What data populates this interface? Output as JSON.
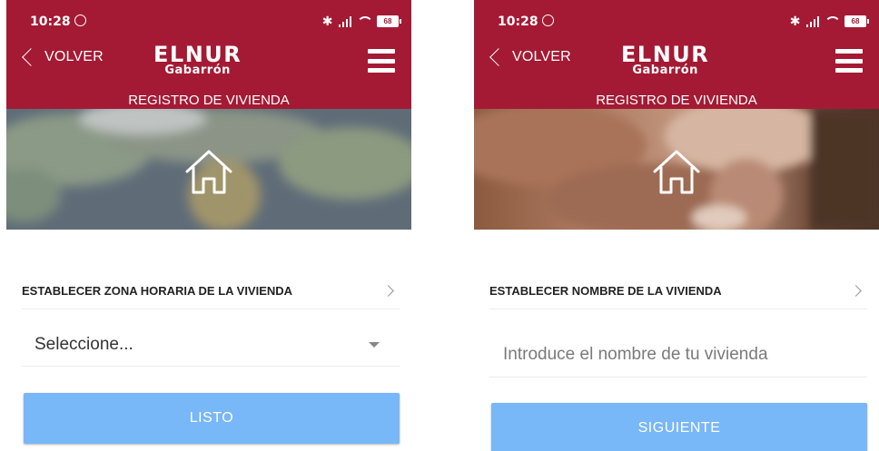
{
  "colors": {
    "brand": "#a41a34",
    "button": "#78b7f8"
  },
  "screens": [
    {
      "status_time": "10:28",
      "battery": "68",
      "back_label": "VOLVER",
      "logo_main": "ELNUR",
      "logo_sub": "Gabarrón",
      "page_title": "REGISTRO DE VIVIENDA",
      "banner_image": "world-map",
      "section_label": "ESTABLECER ZONA HORARIA DE LA VIVIENDA",
      "select_value": "Seleccione...",
      "button_label": "LISTO"
    },
    {
      "status_time": "10:28",
      "battery": "68",
      "back_label": "VOLVER",
      "logo_main": "ELNUR",
      "logo_sub": "Gabarrón",
      "page_title": "REGISTRO DE VIVIENDA",
      "banner_image": "woman-with-tablet-photo",
      "section_label": "ESTABLECER NOMBRE DE LA VIVIENDA",
      "input_placeholder": "Introduce el nombre de tu vivienda",
      "button_label": "SIGUIENTE"
    }
  ]
}
